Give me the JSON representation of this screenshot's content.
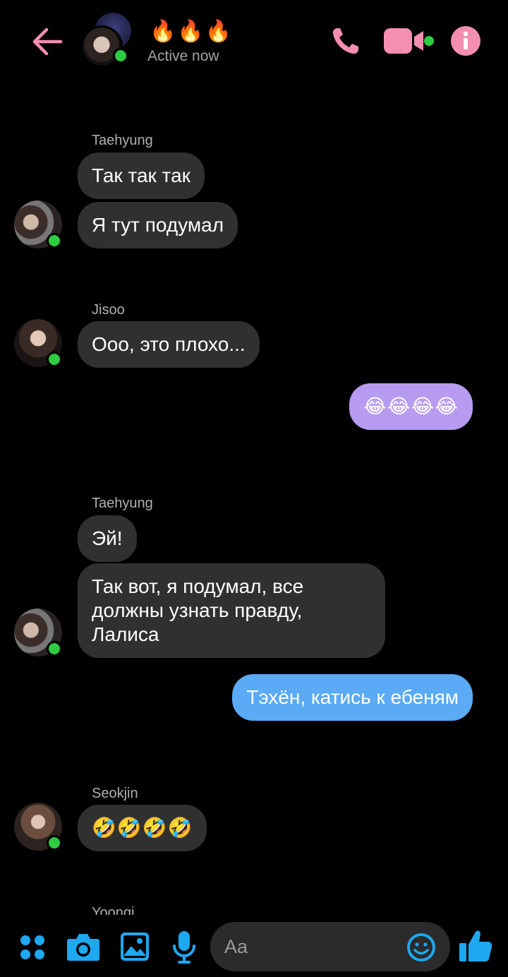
{
  "header": {
    "group_name": "🔥🔥🔥",
    "status": "Active now",
    "accent_color": "#f48fb1",
    "icons": [
      "back-arrow-icon",
      "phone-icon",
      "video-camera-icon",
      "info-icon"
    ]
  },
  "messages": [
    {
      "sender": "Taehyung",
      "texts": [
        "Так так так",
        "Я тут подумал"
      ]
    },
    {
      "sender": "Jisoo",
      "texts": [
        "Ооо, это плохо..."
      ]
    },
    {
      "sender": "me",
      "texts": [
        "😂😂😂😂"
      ],
      "color": "#b79bf0"
    },
    {
      "sender": "Taehyung",
      "texts": [
        "Эй!",
        "Так вот, я подумал, все должны узнать правду, Лалиса"
      ]
    },
    {
      "sender": "me",
      "texts": [
        "Тэхён, катись к ебеням"
      ],
      "color": "#5aaaf5"
    },
    {
      "sender": "Seokjin",
      "texts": [
        "🤣🤣🤣🤣"
      ]
    },
    {
      "sender": "Yoongi",
      "texts": []
    }
  ],
  "composer": {
    "placeholder": "Aa",
    "accent_color": "#1ea8f0",
    "icons": [
      "menu-dots-icon",
      "camera-icon",
      "gallery-icon",
      "microphone-icon",
      "emoji-icon",
      "thumbs-up-icon"
    ]
  }
}
